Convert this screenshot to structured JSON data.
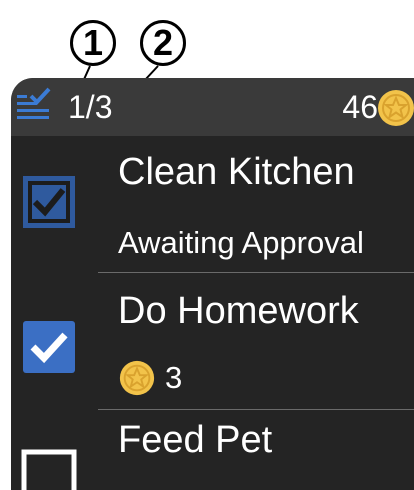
{
  "callouts": {
    "c1": "1",
    "c2": "2"
  },
  "status_bar": {
    "progress": "1/3",
    "coin_count": "46",
    "icon": "checklist-icon"
  },
  "chores": [
    {
      "title": "Clean Kitchen",
      "subtitle": "Awaiting Approval",
      "state": "awaiting-approval"
    },
    {
      "title": "Do Homework",
      "reward": "3",
      "state": "complete"
    },
    {
      "title": "Feed Pet",
      "state": "incomplete"
    }
  ],
  "colors": {
    "screen_bg": "#242424",
    "status_bg": "#3a3a3a",
    "check_blue": "#3b6fc4",
    "check_blue_dim": "#2f5a9e",
    "coin_gold": "#f2c34a"
  }
}
